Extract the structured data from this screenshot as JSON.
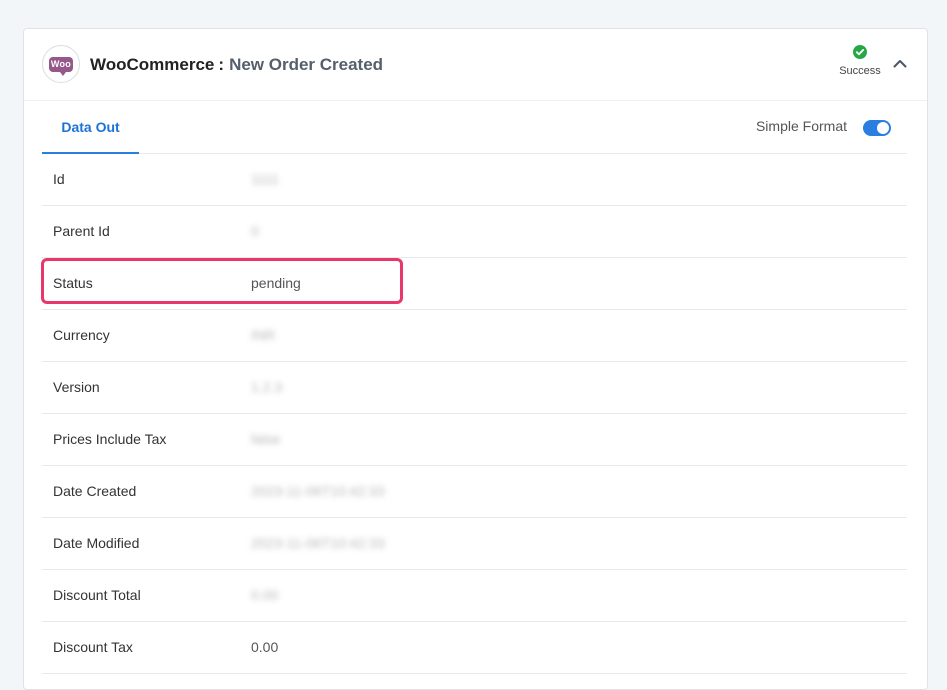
{
  "header": {
    "app_name": "WooCommerce",
    "separator": ":",
    "event_name": "New Order Created",
    "status": "Success",
    "logo_text": "Woo",
    "logo_color": "#96588a",
    "success_color": "#28a745"
  },
  "tabs": {
    "active_label": "Data Out"
  },
  "format": {
    "label": "Simple Format",
    "enabled": true,
    "toggle_color": "#2a7ee0"
  },
  "rows": [
    {
      "label": "Id",
      "value": "1111"
    },
    {
      "label": "Parent Id",
      "value": "0"
    },
    {
      "label": "Status",
      "value": "pending"
    },
    {
      "label": "Currency",
      "value": "INR"
    },
    {
      "label": "Version",
      "value": "1.2.3"
    },
    {
      "label": "Prices Include Tax",
      "value": "false"
    },
    {
      "label": "Date Created",
      "value": "2023-11-06T10:42:33"
    },
    {
      "label": "Date Modified",
      "value": "2023-11-06T10:42:33"
    },
    {
      "label": "Discount Total",
      "value": "0.00"
    },
    {
      "label": "Discount Tax",
      "value": "0.00"
    }
  ],
  "highlight_color": "#e8386b"
}
